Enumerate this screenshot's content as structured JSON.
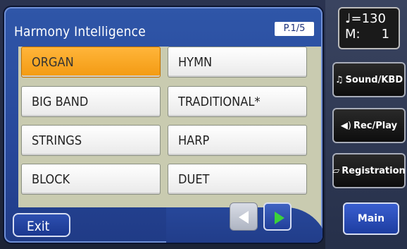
{
  "panel": {
    "title": "Harmony Intelligence",
    "page_indicator": "P.1/5"
  },
  "options": [
    {
      "label": "ORGAN",
      "selected": true
    },
    {
      "label": "HYMN",
      "selected": false
    },
    {
      "label": "BIG BAND",
      "selected": false
    },
    {
      "label": "TRADITIONAL*",
      "selected": false
    },
    {
      "label": "STRINGS",
      "selected": false
    },
    {
      "label": "HARP",
      "selected": false
    },
    {
      "label": "BLOCK",
      "selected": false
    },
    {
      "label": "DUET",
      "selected": false
    }
  ],
  "exit_label": "Exit",
  "nav": {
    "prev_icon": "left-arrow-icon",
    "next_icon": "right-arrow-icon"
  },
  "sidebar": {
    "tempo_symbol": "♩",
    "tempo_value": "=130",
    "measure_label": "M:",
    "measure_value": "1",
    "buttons": [
      {
        "label": "Sound/KBD",
        "icon": "music-note-icon"
      },
      {
        "label": "Rec/Play",
        "icon": "speaker-icon"
      },
      {
        "label": "Registration",
        "icon": "book-icon"
      }
    ],
    "main_label": "Main"
  },
  "colors": {
    "selected": "#F7A21B",
    "panel": "#2A4BA0",
    "grid_bg": "#C9CBB0",
    "next_arrow": "#3BD23B"
  }
}
